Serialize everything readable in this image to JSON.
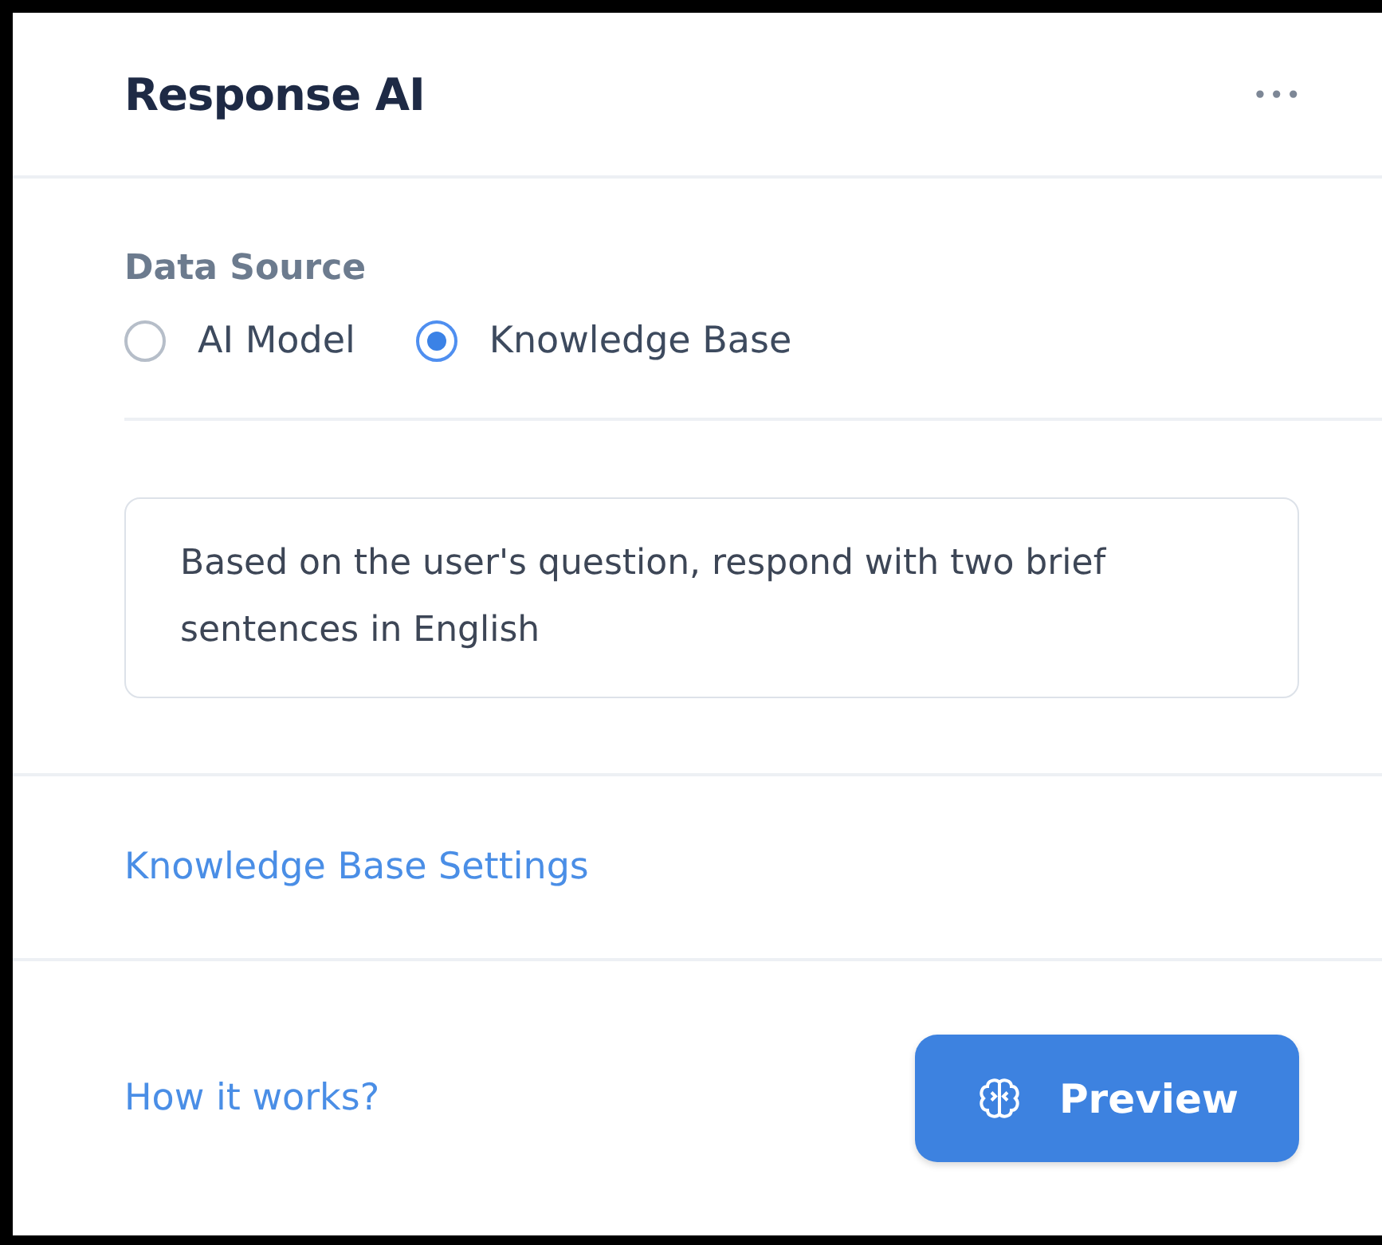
{
  "panel": {
    "title": "Response AI",
    "menu_icon": "•••"
  },
  "data_source": {
    "label": "Data Source",
    "options": [
      {
        "label": "AI Model",
        "selected": false
      },
      {
        "label": "Knowledge Base",
        "selected": true
      }
    ]
  },
  "prompt": {
    "value": "Based on the user's question, respond with two brief sentences in English"
  },
  "settings_link": "Knowledge Base Settings",
  "footer": {
    "help_link": "How it works?",
    "preview_button": "Preview"
  }
}
